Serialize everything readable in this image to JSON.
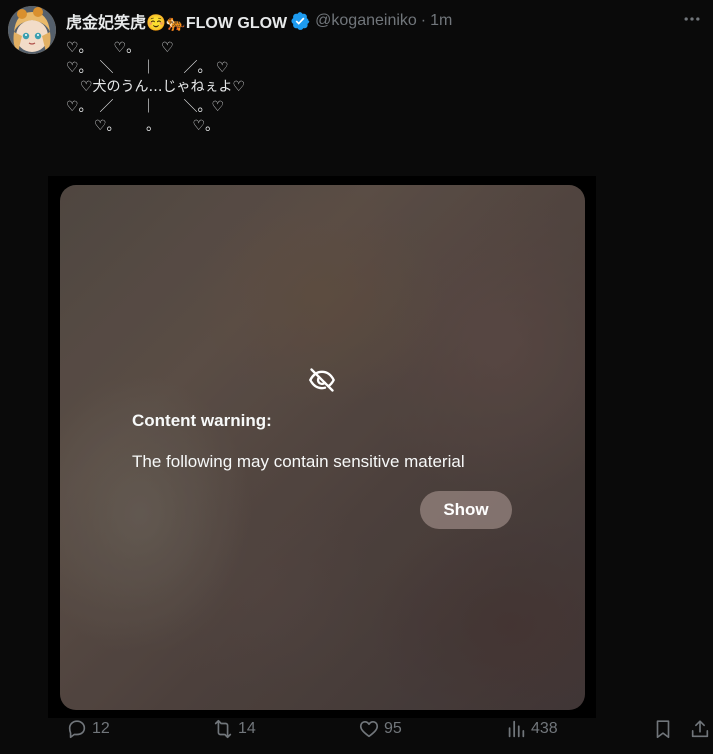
{
  "tweet": {
    "display_name": "虎金妃笑虎☺️🐅FLOW GLOW",
    "handle": "@koganeiniko",
    "separator": "·",
    "time": "1m",
    "text_lines": [
      "♡。　　♡。　　♡",
      "♡。　＼　　｜　　／。 ♡",
      "　♡犬のうん…じゃねぇよ♡",
      "♡。　／　　｜　　＼。♡",
      "　　♡。　　 。 　　♡。"
    ]
  },
  "media": {
    "warning_title": "Content warning:",
    "warning_text": "The following may contain sensitive material",
    "show_label": "Show"
  },
  "actions": {
    "replies": "12",
    "retweets": "14",
    "likes": "95",
    "views": "438"
  },
  "icons": {
    "verified": "verified-badge-icon",
    "more": "more-icon",
    "eye_off": "eye-off-icon",
    "reply": "reply-icon",
    "retweet": "retweet-icon",
    "like": "heart-icon",
    "views": "views-icon",
    "bookmark": "bookmark-icon",
    "share": "share-icon"
  },
  "colors": {
    "background": "#0a0a0a",
    "text": "#e7e9ea",
    "muted": "#71767b",
    "verified": "#1d9bf0"
  }
}
